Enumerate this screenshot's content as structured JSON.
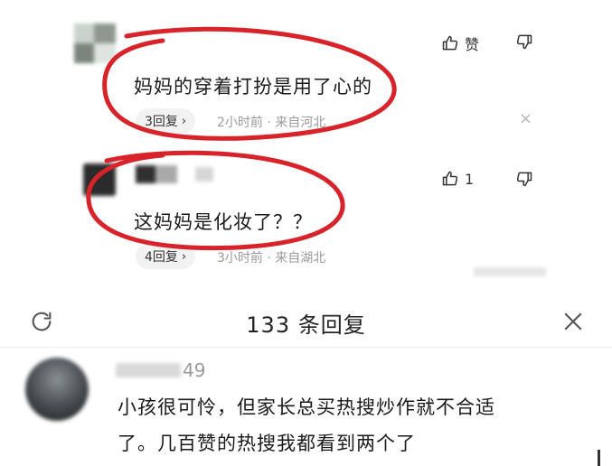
{
  "comments": [
    {
      "text": "妈妈的穿着打扮是用了心的",
      "reply_label": "3回复",
      "meta": "2小时前 · 来自河北",
      "like_label": "赞"
    },
    {
      "text": "这妈妈是化妆了？？",
      "reply_label": "4回复",
      "meta": "3小时前 · 来自湖北",
      "like_label": "1"
    }
  ],
  "panel": {
    "title": "133 条回复",
    "reply": {
      "username": "49",
      "text_line1": "小孩很可怜，但家长总买热搜炒作就不合适",
      "text_line2": "了。几百赞的热搜我都看到两个了"
    }
  },
  "icons": {
    "refresh": "refresh-icon",
    "close": "close-icon",
    "like": "thumbs-up-icon",
    "dislike": "thumbs-down-icon"
  },
  "colors": {
    "annotation_red": "#d8232a",
    "meta_gray": "#9a9a9a"
  }
}
